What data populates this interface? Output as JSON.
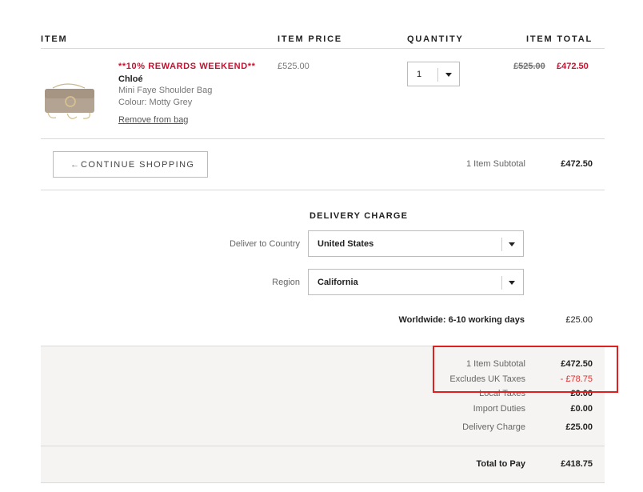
{
  "table_headers": {
    "item": "ITEM",
    "item_price": "ITEM PRICE",
    "quantity": "QUANTITY",
    "item_total": "ITEM TOTAL"
  },
  "line_item": {
    "promo": "**10% REWARDS WEEKEND**",
    "brand": "Chloé",
    "name": "Mini Faye Shoulder Bag",
    "colour": "Colour: Motty Grey",
    "remove_label": "Remove from bag",
    "item_price": "£525.00",
    "quantity": "1",
    "original_total": "£525.00",
    "discounted_total": "£472.50",
    "image_icon": "handbag-thumbnail"
  },
  "cart_actions": {
    "continue_arrow": "←",
    "continue_label": "CONTINUE SHOPPING",
    "subtotal_label": "1 Item Subtotal",
    "subtotal_value": "£472.50"
  },
  "delivery": {
    "title": "DELIVERY CHARGE",
    "country_label": "Deliver to Country",
    "country_value": "United States",
    "region_label": "Region",
    "region_value": "California",
    "method_label": "Worldwide: 6-10 working days",
    "method_value": "£25.00"
  },
  "summary": {
    "subtotal_label": "1 Item Subtotal",
    "subtotal_value": "£472.50",
    "tax_label": "Excludes UK Taxes",
    "tax_value": "- £78.75",
    "local_taxes_label": "Local Taxes",
    "local_taxes_value": "£0.00",
    "import_duties_label": "Import Duties",
    "import_duties_value": "£0.00",
    "delivery_label": "Delivery Charge",
    "delivery_value": "£25.00",
    "total_label": "Total to Pay",
    "total_value": "£418.75"
  },
  "colors": {
    "promo_red": "#c8102e",
    "highlight_box": "#e02020",
    "panel_bg": "#f5f4f2"
  }
}
